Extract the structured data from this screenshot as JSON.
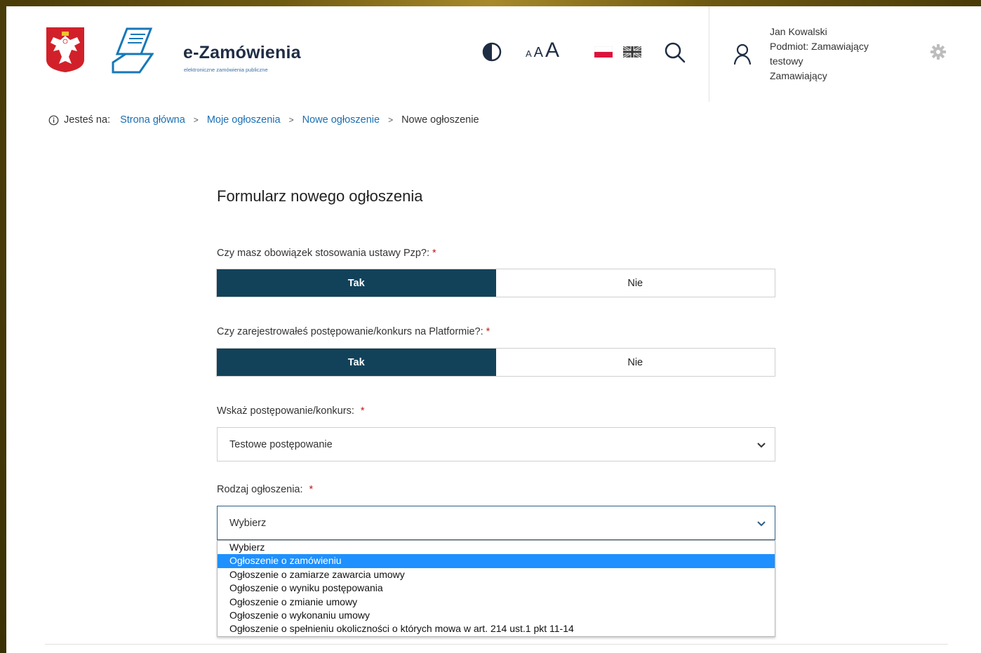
{
  "header": {
    "brand_name": "e-Zamówienia",
    "brand_tagline": "elektroniczne zamówienia publiczne",
    "font_size_small": "A",
    "font_size_medium": "A",
    "font_size_large": "A",
    "user": {
      "name": "Jan Kowalski",
      "entity_line1": "Podmiot: Zamawiający",
      "entity_line2": "testowy",
      "role": "Zamawiający"
    },
    "icons": [
      "polish-emblem-icon",
      "brand-logo-icon",
      "contrast-icon",
      "flag-pl-icon",
      "flag-uk-icon",
      "search-icon",
      "user-icon",
      "gear-icon"
    ]
  },
  "breadcrumb": {
    "prefix": "Jesteś na:",
    "items": [
      "Strona główna",
      "Moje ogłoszenia",
      "Nowe ogłoszenie",
      "Nowe ogłoszenie"
    ],
    "separator": ">"
  },
  "form": {
    "title": "Formularz nowego ogłoszenia",
    "required_mark": "*",
    "q1": {
      "label": "Czy masz obowiązek stosowania ustawy Pzp?:",
      "yes": "Tak",
      "no": "Nie",
      "selected": "Tak"
    },
    "q2": {
      "label": "Czy zarejestrowałeś postępowanie/konkurs na Platformie?:",
      "yes": "Tak",
      "no": "Nie",
      "selected": "Tak"
    },
    "procedure": {
      "label": "Wskaż postępowanie/konkurs:",
      "value": "Testowe postępowanie"
    },
    "notice_type": {
      "label": "Rodzaj ogłoszenia:",
      "value": "Wybierz",
      "options": [
        "Wybierz",
        "Ogłoszenie o zamówieniu",
        "Ogłoszenie o zamiarze zawarcia umowy",
        "Ogłoszenie o wyniku postępowania",
        "Ogłoszenie o zmianie umowy",
        "Ogłoszenie o wykonaniu umowy",
        "Ogłoszenie o spełnieniu okoliczności o których mowa w art. 214 ust.1 pkt 11-14"
      ],
      "highlighted": "Ogłoszenie o zamówieniu"
    }
  },
  "colors": {
    "accent_dark": "#12425a",
    "link": "#1a6fb3",
    "highlight": "#1e90ff",
    "required": "#c11a1a"
  }
}
